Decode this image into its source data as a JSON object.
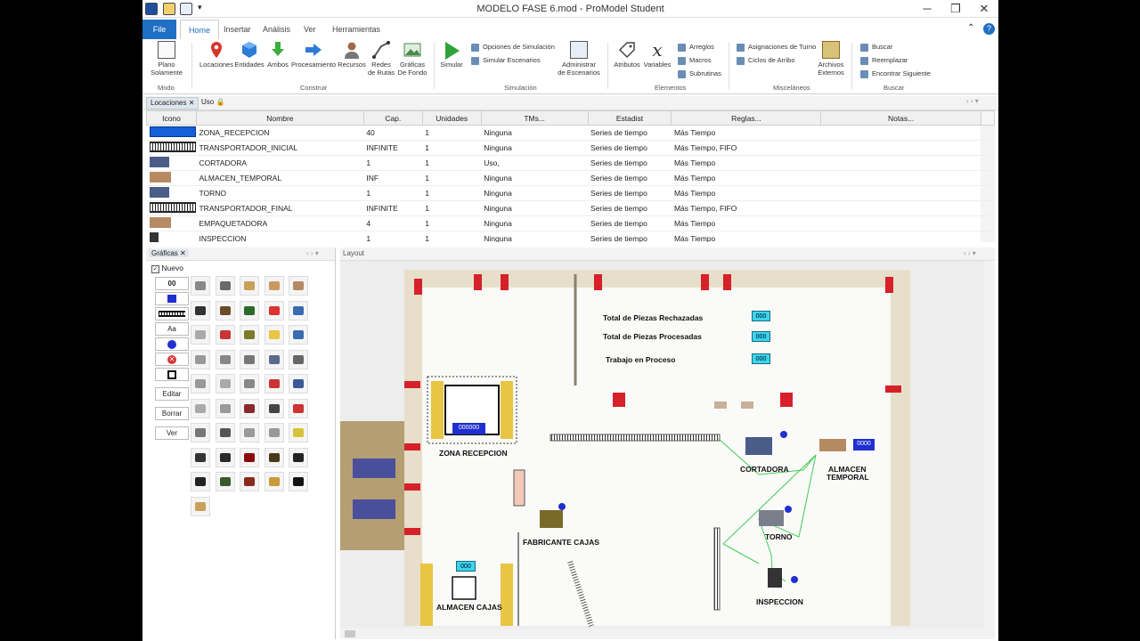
{
  "window": {
    "title": "MODELO FASE 6.mod - ProModel Student"
  },
  "tabs": [
    {
      "label": "File"
    },
    {
      "label": "Home"
    },
    {
      "label": "Insertar"
    },
    {
      "label": "Análisis"
    },
    {
      "label": "Ver"
    },
    {
      "label": "Herramientas"
    }
  ],
  "ribbon": {
    "modo": {
      "plano": "Plano Solamente",
      "group": "Modo"
    },
    "construir": {
      "locaciones": "Locaciones",
      "entidades": "Entidades",
      "arribos": "Arribos",
      "procesamiento": "Procesamiento",
      "recursos": "Recursos",
      "redes1": "Redes",
      "redes2": "de Rutas",
      "graficas1": "Gráficas",
      "graficas2": "De Fondo",
      "group": "Construir"
    },
    "simulacion": {
      "simular": "Simular",
      "opciones": "Opciones de Simulación",
      "escenarios": "Simular Escenarios",
      "admin1": "Administrar",
      "admin2": "de Escenarios",
      "group": "Simulación"
    },
    "elementos": {
      "atributos": "Atributos",
      "variables": "Variables",
      "arreglos": "Arreglos",
      "macros": "Macros",
      "subrutinas": "Subrutinas",
      "group": "Elementos"
    },
    "misc": {
      "turno": "Asignaciones de Turno",
      "ciclos": "Ciclos de Arribo",
      "archivos1": "Archivos",
      "archivos2": "Externos",
      "group": "Misceláneos"
    },
    "buscar": {
      "buscar": "Buscar",
      "reemplazar": "Reemplazar",
      "siguiente": "Encontrar Siguiente",
      "group": "Buscar"
    }
  },
  "loc_tabs": {
    "loc": "Locaciones",
    "uso": "Uso"
  },
  "loc_headers": [
    "Icono",
    "Nombre",
    "Cap.",
    "Unidades",
    "TMs...",
    "Estadist",
    "Reglas...",
    "Notas..."
  ],
  "loc_rows": [
    {
      "name": "ZONA_RECEPCION",
      "cap": "40",
      "units": "1",
      "tms": "Ninguna",
      "stats": "Series de tiempo",
      "rules": "Más Tiempo",
      "icon": "blue-rect-icon"
    },
    {
      "name": "TRANSPORTADOR_INICIAL",
      "cap": "INFINITE",
      "units": "1",
      "tms": "Ninguna",
      "stats": "Series de tiempo",
      "rules": "Más Tiempo, FIFO",
      "icon": "conveyor-icon"
    },
    {
      "name": "CORTADORA",
      "cap": "1",
      "units": "1",
      "tms": "Uso,",
      "stats": "Series de tiempo",
      "rules": "Más Tiempo",
      "icon": "machine-icon"
    },
    {
      "name": "ALMACEN_TEMPORAL",
      "cap": "INF",
      "units": "1",
      "tms": "Ninguna",
      "stats": "Series de tiempo",
      "rules": "Más Tiempo",
      "icon": "pallet-icon"
    },
    {
      "name": "TORNO",
      "cap": "1",
      "units": "1",
      "tms": "Ninguna",
      "stats": "Series de tiempo",
      "rules": "Más Tiempo",
      "icon": "lathe-icon"
    },
    {
      "name": "TRANSPORTADOR_FINAL",
      "cap": "INFINITE",
      "units": "1",
      "tms": "Ninguna",
      "stats": "Series de tiempo",
      "rules": "Más Tiempo, FIFO",
      "icon": "conveyor-icon"
    },
    {
      "name": "EMPAQUETADORA",
      "cap": "4",
      "units": "1",
      "tms": "Ninguna",
      "stats": "Series de tiempo",
      "rules": "Más Tiempo",
      "icon": "pallet-icon"
    },
    {
      "name": "INSPECCION",
      "cap": "1",
      "units": "1",
      "tms": "Ninguna",
      "stats": "Series de tiempo",
      "rules": "Más Tiempo",
      "icon": "worker-icon"
    }
  ],
  "graficas": {
    "title": "Gráficas",
    "nuevo": "Nuevo",
    "counter": "00",
    "text_tool": "Aa",
    "editar": "Editar",
    "borrar": "Borrar",
    "ver": "Ver"
  },
  "layout": {
    "title": "Layout",
    "rechazadas": "Total de Piezas Rechazadas",
    "procesadas": "Total de Piezas Procesadas",
    "wip": "Trabajo en Proceso",
    "ctr": "000",
    "ctr6": "000000",
    "ctr4": "0000",
    "ctr3": "000",
    "zona": "ZONA RECEPCION",
    "cortadora": "CORTADORA",
    "almacen1": "ALMACEN",
    "almacen2": "TEMPORAL",
    "torno": "TORNO",
    "fabricante": "FABRICANTE CAJAS",
    "inspeccion": "INSPECCION",
    "almacen_cajas": "ALMACEN CAJAS"
  },
  "colors": {
    "accent": "#1f6fc5",
    "selection": "#1560d8",
    "counter": "#3ad6e8",
    "wall": "#e7dfc9",
    "path": "#44cc55"
  }
}
